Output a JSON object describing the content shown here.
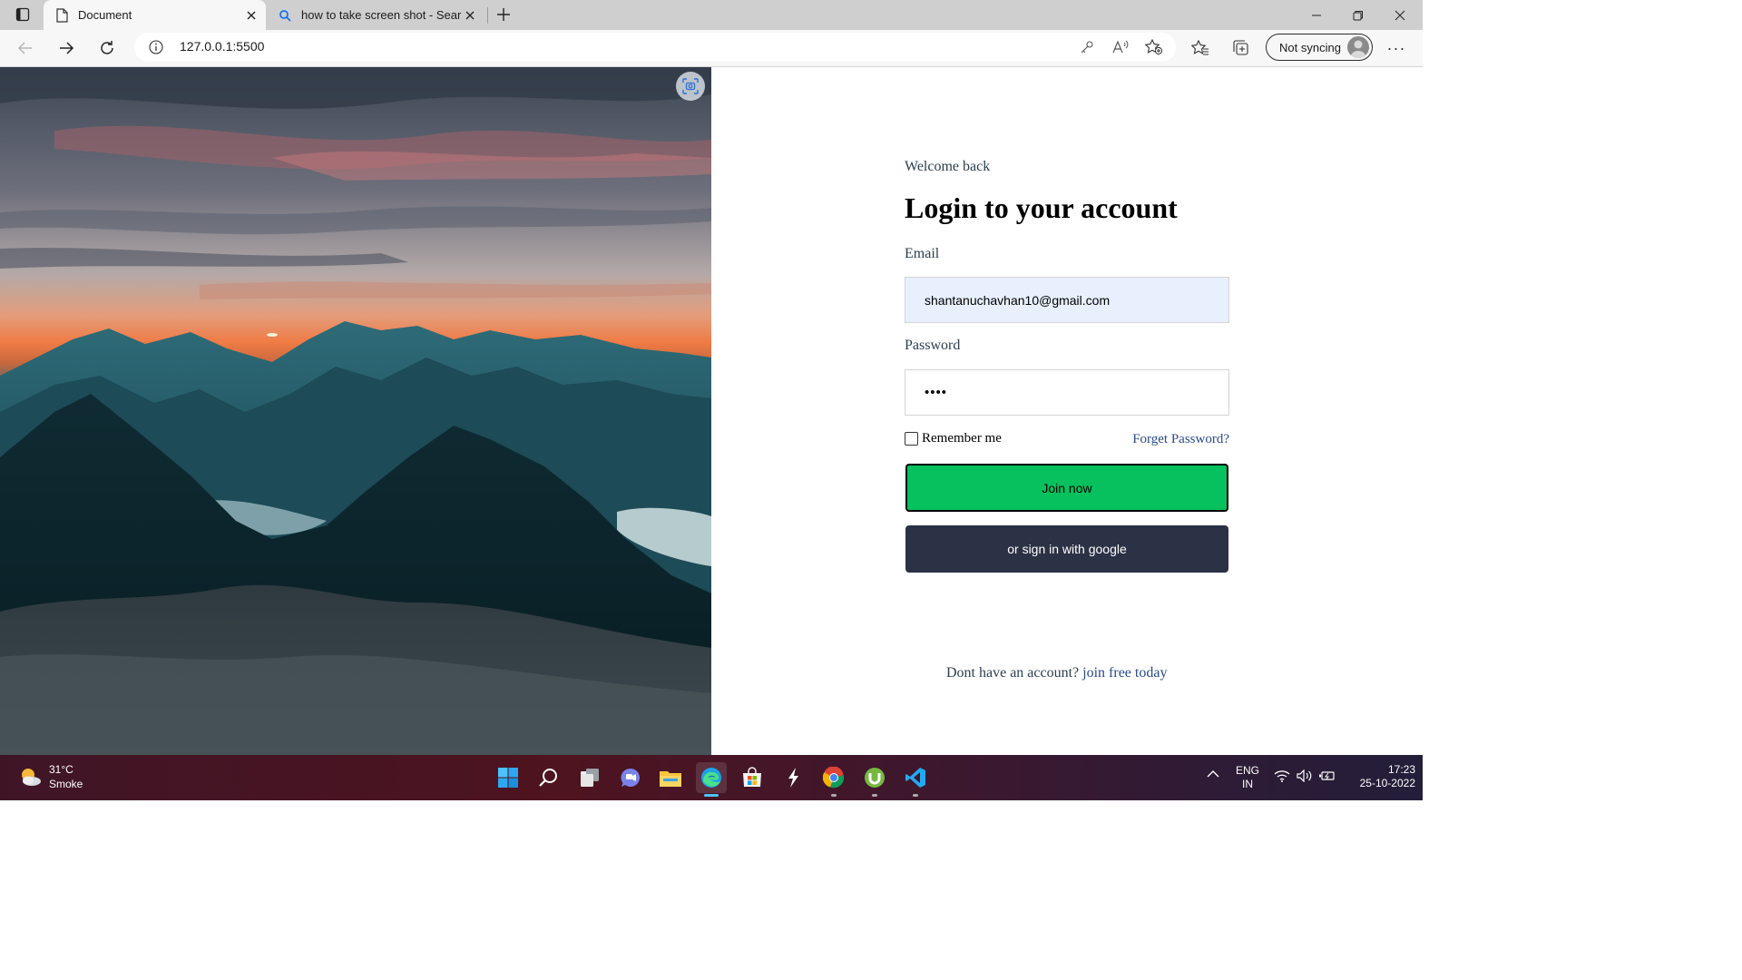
{
  "browser": {
    "tabs": [
      {
        "title": "Document",
        "icon": "page-icon",
        "active": true
      },
      {
        "title": "how to take screen shot - Search",
        "icon": "search-icon",
        "active": false
      }
    ],
    "address": "127.0.0.1:5500",
    "sync_label": "Not syncing"
  },
  "login": {
    "welcome": "Welcome back",
    "heading": "Login to your account",
    "email_label": "Email",
    "email_value": "shantanuchavhan10@gmail.com",
    "password_label": "Password",
    "password_value": "••••",
    "remember_label": "Remember me",
    "forgot_label": "Forget Password?",
    "join_button": "Join now",
    "google_button": "or sign in with google",
    "signup_prompt": "Dont have an account?",
    "signup_link": "join free today",
    "colors": {
      "join": "#06c15d",
      "google": "#2c3245",
      "link": "#2b4a8b"
    }
  },
  "taskbar": {
    "weather_temp": "31°C",
    "weather_desc": "Smoke",
    "apps": [
      "windows-start-icon",
      "search-icon",
      "task-view-icon",
      "teams-chat-icon",
      "file-explorer-icon",
      "edge-icon",
      "store-icon",
      "app-bolt-icon",
      "chrome-icon",
      "utorrent-icon",
      "vscode-icon"
    ],
    "lang_line1": "ENG",
    "lang_line2": "IN",
    "time": "17:23",
    "date": "25-10-2022"
  }
}
